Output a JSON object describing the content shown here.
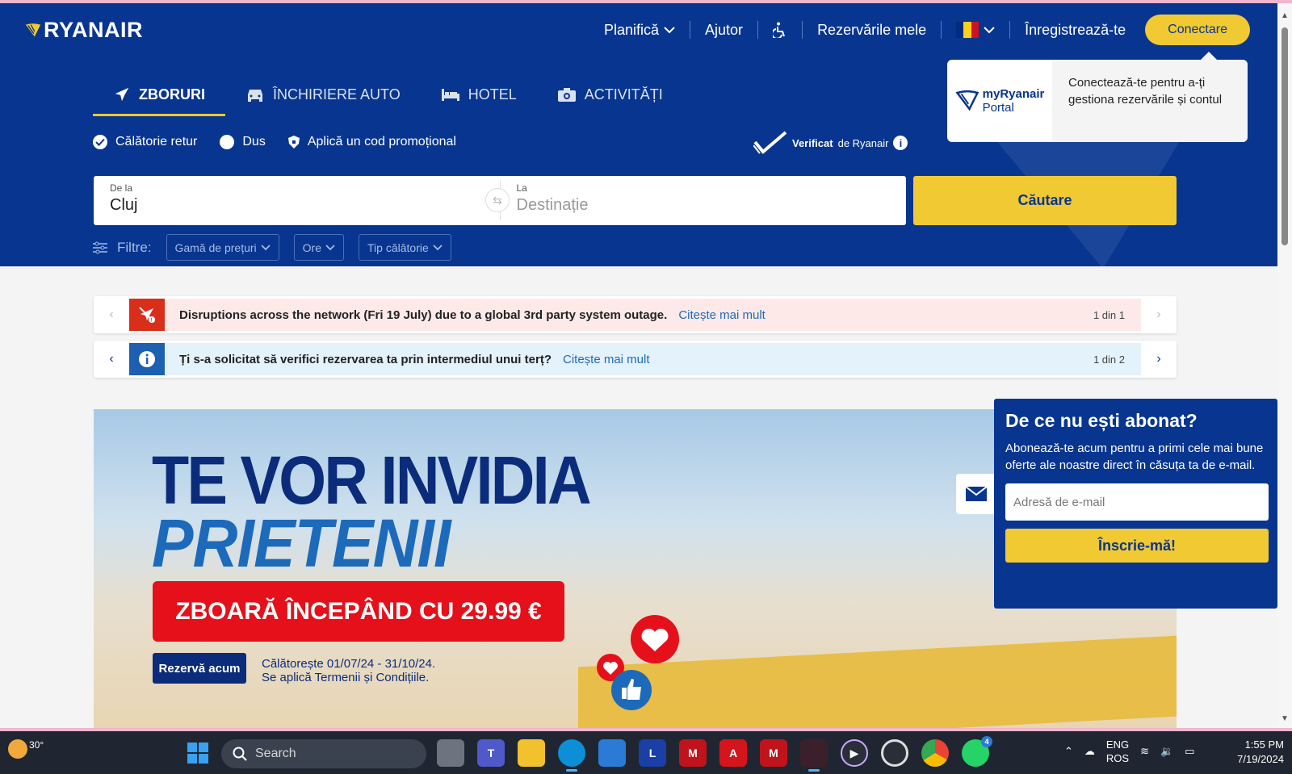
{
  "header": {
    "logo_text": "RYANAIR",
    "nav": {
      "plan": "Planifică",
      "help": "Ajutor",
      "my_bookings": "Rezervările mele",
      "signup": "Înregistrează-te",
      "login": "Conectare"
    },
    "popover": {
      "brand_line1": "myRyanair",
      "brand_line2": "Portal",
      "text": "Conectează-te pentru a-ți gestiona rezervările și contul"
    },
    "tabs": [
      {
        "label": "ZBORURI",
        "icon": "plane-icon"
      },
      {
        "label": "ÎNCHIRIERE AUTO",
        "icon": "car-icon"
      },
      {
        "label": "HOTEL",
        "icon": "bed-icon"
      },
      {
        "label": "ACTIVITĂȚI",
        "icon": "camera-icon"
      }
    ],
    "options": {
      "return": "Călătorie retur",
      "one_way": "Dus",
      "promo": "Aplică un cod promoțional"
    },
    "verified_bold": "Verificat",
    "verified_rest": "de Ryanair",
    "search": {
      "from_label": "De la",
      "from_value": "Cluj",
      "to_label": "La",
      "to_placeholder": "Destinație",
      "button": "Căutare"
    },
    "filters": {
      "label": "Filtre:",
      "items": [
        "Gamă de prețuri",
        "Ore",
        "Tip călătorie"
      ]
    }
  },
  "banners": [
    {
      "message": "Disruptions across the network (Fri 19 July) due to a global 3rd party system outage.",
      "link": "Citește mai mult",
      "counter": "1 din 1",
      "bg": "#fdeae8",
      "icon_bg": "#d92e1a"
    },
    {
      "message": "Ți s-a solicitat să verifici rezervarea ta prin intermediul unui terț?",
      "link": "Citește mai mult",
      "counter": "1 din 2",
      "bg": "#e4f2fb",
      "icon_bg": "#1d5fb0"
    }
  ],
  "hero": {
    "line1": "TE VOR INVIDIA",
    "line2": "PRIETENII",
    "promo": "ZBOARĂ ÎNCEPÂND CU 29.99 €",
    "book": "Rezervă acum",
    "terms_line1": "Călătorește 01/07/24 - 31/10/24.",
    "terms_line2": "Se aplică Termenii și Condițiile."
  },
  "newsletter": {
    "title": "De ce nu ești abonat?",
    "text": "Abonează-te acum pentru a primi cele mai bune oferte ale noastre direct în căsuța ta de e-mail.",
    "email_placeholder": "Adresă de e-mail",
    "button": "Înscrie-mă!"
  },
  "taskbar": {
    "temp": "30°",
    "search": "Search",
    "lang1": "ENG",
    "lang2": "ROS",
    "time": "1:55 PM",
    "date": "7/19/2024",
    "whatsapp_badge": "4"
  },
  "colors": {
    "brand_blue": "#073590",
    "brand_yellow": "#f1c933"
  }
}
